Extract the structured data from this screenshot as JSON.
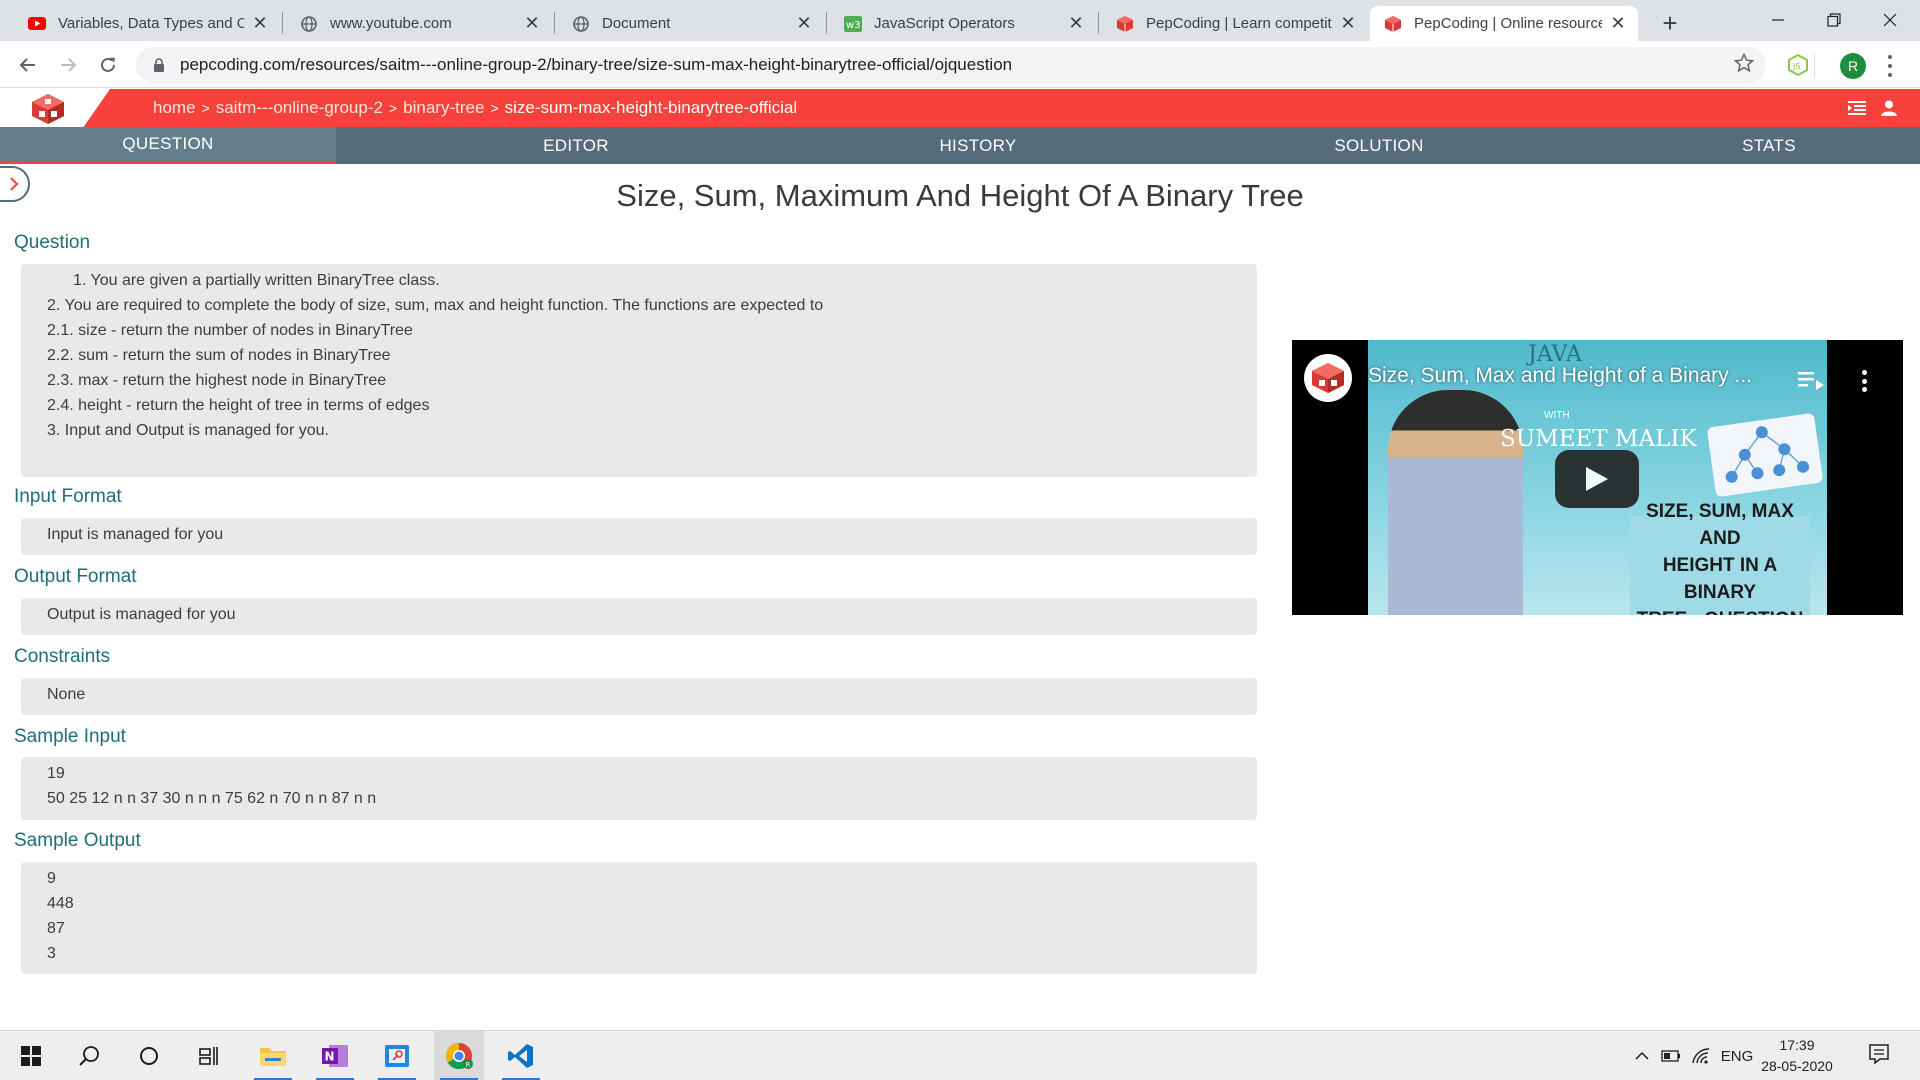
{
  "browser": {
    "tabs": [
      {
        "title": "Variables, Data Types and Op",
        "icon": "youtube-icon",
        "active": false
      },
      {
        "title": "www.youtube.com",
        "icon": "globe-icon",
        "active": false
      },
      {
        "title": "Document",
        "icon": "globe-icon",
        "active": false
      },
      {
        "title": "JavaScript Operators",
        "icon": "w3schools-icon",
        "active": false
      },
      {
        "title": "PepCoding | Learn competiti",
        "icon": "pepcoding-icon",
        "active": false
      },
      {
        "title": "PepCoding | Online resource",
        "icon": "pepcoding-icon",
        "active": true
      }
    ],
    "close_glyph": "✕",
    "new_tab_glyph": "+",
    "url": "pepcoding.com/resources/saitm---online-group-2/binary-tree/size-sum-max-height-binarytree-official/ojquestion",
    "profile_initial": "R"
  },
  "breadcrumb": {
    "items": [
      "home",
      "saitm---online-group-2",
      "binary-tree",
      "size-sum-max-height-binarytree-official"
    ],
    "separator": ">"
  },
  "nav_tabs": [
    {
      "label": "QUESTION",
      "active": true
    },
    {
      "label": "EDITOR",
      "active": false
    },
    {
      "label": "HISTORY",
      "active": false
    },
    {
      "label": "SOLUTION",
      "active": false
    },
    {
      "label": "STATS",
      "active": false
    }
  ],
  "problem": {
    "title": "Size, Sum, Maximum And Height Of A Binary Tree",
    "question_label": "Question",
    "question_lines": [
      "1. You are given a partially written BinaryTree class.",
      "2. You are required to complete the body of size, sum, max and height function. The functions are expected to",
      "2.1. size - return the number of nodes in BinaryTree",
      "2.2. sum - return the sum of nodes in BinaryTree",
      "2.3. max - return the highest node in BinaryTree",
      "2.4. height - return the height of tree in terms of edges",
      "3. Input and Output is managed for you."
    ],
    "input_format_label": "Input Format",
    "input_format": "Input is managed for you",
    "output_format_label": "Output Format",
    "output_format": "Output is managed for you",
    "constraints_label": "Constraints",
    "constraints": "None",
    "sample_input_label": "Sample Input",
    "sample_input_lines": [
      "19",
      "50 25 12 n n 37 30 n n n 75 62 n 70 n n 87 n n"
    ],
    "sample_output_label": "Sample Output",
    "sample_output_lines": [
      "9",
      "448",
      "87",
      "3"
    ]
  },
  "video": {
    "title": "Size, Sum, Max and Height of a Binary ...",
    "thumb_banner": "JAVA",
    "thumb_with": "WITH",
    "thumb_presenter": "SUMEET MALIK",
    "thumb_caption_lines": [
      "SIZE, SUM, MAX AND",
      "HEIGHT IN A BINARY",
      "TREE - QUESTION"
    ]
  },
  "taskbar": {
    "language": "ENG",
    "time": "17:39",
    "date": "28-05-2020"
  },
  "colors": {
    "brand_red": "#f6423a",
    "nav_slate": "#556c7a",
    "section_teal": "#1f6e78",
    "box_gray": "#e9e9e9"
  }
}
